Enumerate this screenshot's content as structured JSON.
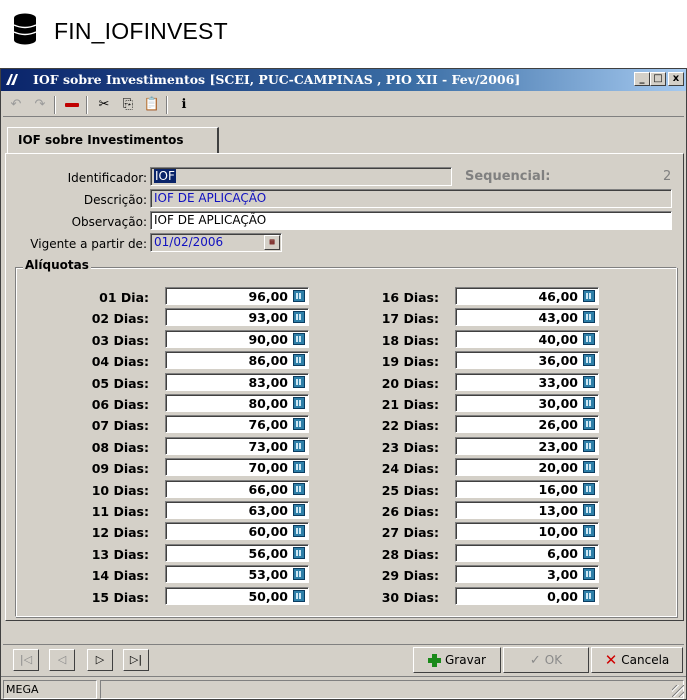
{
  "page": {
    "title": "FIN_IOFINVEST"
  },
  "window": {
    "title": "IOF sobre Investimentos [SCEI, PUC-CAMPINAS , PIO XII - Fev/2006]",
    "app_icon_text": "MEGA",
    "buttons": {
      "minimize": "_",
      "maximize": "□",
      "close": "x"
    }
  },
  "toolbar": {
    "undo": "↶",
    "redo": "↷",
    "cut": "✂",
    "copy": "⎘",
    "paste": "📋",
    "info": "ℹ"
  },
  "tab": {
    "label": "IOF sobre Investimentos"
  },
  "form": {
    "identificador_label": "Identificador:",
    "identificador_value": "IOF",
    "sequencial_label": "Sequencial:",
    "sequencial_value": "2",
    "descricao_label": "Descrição:",
    "descricao_value": "IOF DE APLICAÇÃO",
    "observacao_label": "Observação:",
    "observacao_value": "IOF DE APLICAÇÃO",
    "vigente_label": "Vigente a partir de:",
    "vigente_value": "01/02/2006"
  },
  "aliquotas": {
    "title": "Alíquotas",
    "left": [
      {
        "label": "01 Dia:",
        "value": "96,00"
      },
      {
        "label": "02 Dias:",
        "value": "93,00"
      },
      {
        "label": "03 Dias:",
        "value": "90,00"
      },
      {
        "label": "04 Dias:",
        "value": "86,00"
      },
      {
        "label": "05 Dias:",
        "value": "83,00"
      },
      {
        "label": "06 Dias:",
        "value": "80,00"
      },
      {
        "label": "07 Dias:",
        "value": "76,00"
      },
      {
        "label": "08 Dias:",
        "value": "73,00"
      },
      {
        "label": "09 Dias:",
        "value": "70,00"
      },
      {
        "label": "10 Dias:",
        "value": "66,00"
      },
      {
        "label": "11 Dias:",
        "value": "63,00"
      },
      {
        "label": "12 Dias:",
        "value": "60,00"
      },
      {
        "label": "13 Dias:",
        "value": "56,00"
      },
      {
        "label": "14 Dias:",
        "value": "53,00"
      },
      {
        "label": "15 Dias:",
        "value": "50,00"
      }
    ],
    "right": [
      {
        "label": "16 Dias:",
        "value": "46,00"
      },
      {
        "label": "17 Dias:",
        "value": "43,00"
      },
      {
        "label": "18 Dias:",
        "value": "40,00"
      },
      {
        "label": "19 Dias:",
        "value": "36,00"
      },
      {
        "label": "20 Dias:",
        "value": "33,00"
      },
      {
        "label": "21 Dias:",
        "value": "30,00"
      },
      {
        "label": "22 Dias:",
        "value": "26,00"
      },
      {
        "label": "23 Dias:",
        "value": "23,00"
      },
      {
        "label": "24 Dias:",
        "value": "20,00"
      },
      {
        "label": "25 Dias:",
        "value": "16,00"
      },
      {
        "label": "26 Dias:",
        "value": "13,00"
      },
      {
        "label": "27 Dias:",
        "value": "10,00"
      },
      {
        "label": "28 Dias:",
        "value": "6,00"
      },
      {
        "label": "29 Dias:",
        "value": "3,00"
      },
      {
        "label": "30 Dias:",
        "value": "0,00"
      }
    ]
  },
  "nav": {
    "first": "|◁",
    "prev": "◁",
    "next": "▷",
    "last": "▷|"
  },
  "actions": {
    "gravar": "Gravar",
    "ok": "OK",
    "cancela": "Cancela"
  },
  "status": {
    "user": "MEGA",
    "message": ""
  }
}
